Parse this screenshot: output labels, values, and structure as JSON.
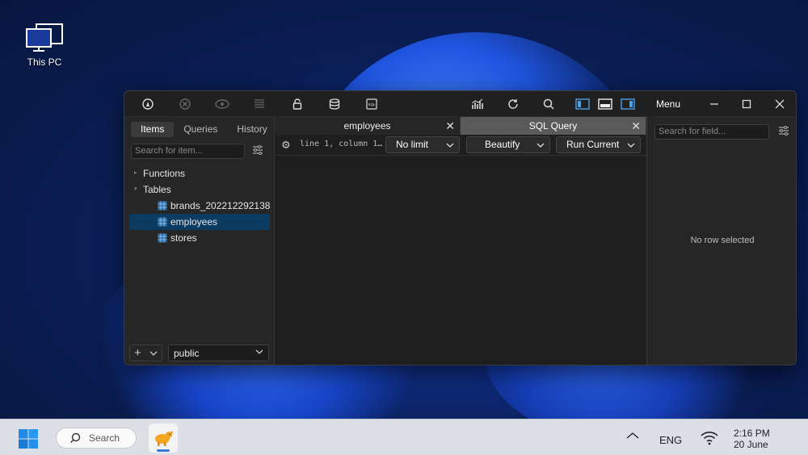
{
  "desktop": {
    "icons": [
      {
        "label": "This PC",
        "icon": "monitor-icon"
      }
    ]
  },
  "window": {
    "toolbar": {
      "menu_label": "Menu"
    },
    "left_panel": {
      "tabs": [
        "Items",
        "Queries",
        "History"
      ],
      "search_placeholder": "Search for item...",
      "tree": {
        "groups": [
          "Functions",
          "Tables"
        ],
        "tables": [
          "brands_202212292138",
          "employees",
          "stores"
        ],
        "selected_table": "employees"
      },
      "schema_select": "public"
    },
    "editor": {
      "tabs": [
        {
          "label": "employees",
          "active": false
        },
        {
          "label": "SQL Query",
          "active": true
        }
      ],
      "cursor_position": "line 1, column 1…",
      "limit_select": "No limit",
      "beautify_label": "Beautify",
      "run_label": "Run Current"
    },
    "right_panel": {
      "search_placeholder": "Search for field...",
      "empty_message": "No row selected"
    }
  },
  "taskbar": {
    "search_label": "Search",
    "language": "ENG",
    "time": "2:16 PM",
    "date": "20 June"
  },
  "colors": {
    "selection": "#0b3b61",
    "active_tab": "#5a5a5a",
    "accent_blue": "#4aa0e6"
  }
}
